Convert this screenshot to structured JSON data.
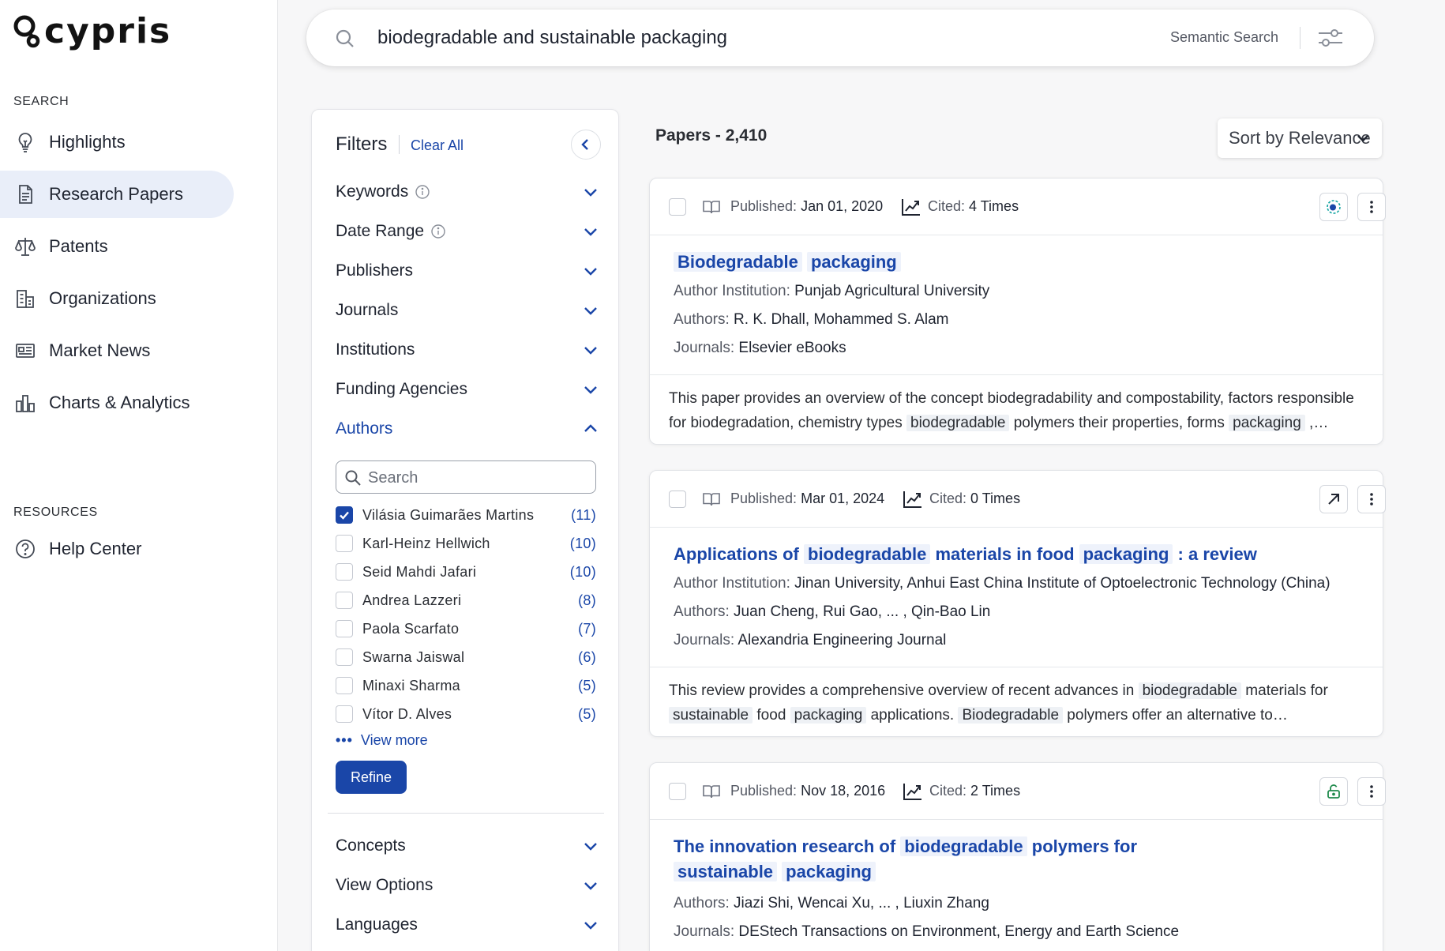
{
  "brand": {
    "name": "cypris"
  },
  "sidebar": {
    "search_heading": "SEARCH",
    "items": [
      {
        "label": "Highlights",
        "icon": "lightbulb-icon"
      },
      {
        "label": "Research Papers",
        "icon": "document-icon",
        "active": true
      },
      {
        "label": "Patents",
        "icon": "scale-icon"
      },
      {
        "label": "Organizations",
        "icon": "building-icon"
      },
      {
        "label": "Market News",
        "icon": "news-icon"
      },
      {
        "label": "Charts & Analytics",
        "icon": "bar-chart-icon"
      }
    ],
    "resources_heading": "RESOURCES",
    "resources": [
      {
        "label": "Help Center",
        "icon": "help-icon"
      }
    ]
  },
  "search": {
    "query": "biodegradable and sustainable packaging",
    "mode_label": "Semantic Search"
  },
  "filters": {
    "title": "Filters",
    "clear_all": "Clear All",
    "groups": [
      {
        "label": "Keywords",
        "has_info": true
      },
      {
        "label": "Date Range",
        "has_info": true
      },
      {
        "label": "Publishers"
      },
      {
        "label": "Journals"
      },
      {
        "label": "Institutions"
      },
      {
        "label": "Funding Agencies"
      },
      {
        "label": "Authors",
        "open": true
      }
    ],
    "author_search_placeholder": "Search",
    "authors": [
      {
        "name": "Vilásia Guimarães Martins",
        "count": "(11)",
        "checked": true
      },
      {
        "name": "Karl-Heinz Hellwich",
        "count": "(10)"
      },
      {
        "name": "Seid Mahdi Jafari",
        "count": "(10)"
      },
      {
        "name": "Andrea Lazzeri",
        "count": "(8)"
      },
      {
        "name": "Paola Scarfato",
        "count": "(7)"
      },
      {
        "name": "Swarna Jaiswal",
        "count": "(6)"
      },
      {
        "name": "Minaxi Sharma",
        "count": "(5)"
      },
      {
        "name": "Vítor D. Alves",
        "count": "(5)"
      }
    ],
    "view_more": "View more",
    "refine": "Refine",
    "lower_groups": [
      {
        "label": "Concepts"
      },
      {
        "label": "View Options"
      },
      {
        "label": "Languages"
      }
    ]
  },
  "results": {
    "count_label": "Papers - 2,410",
    "sort_label": "Sort by Relevance",
    "papers": [
      {
        "published_label": "Published:",
        "published": "Jan 01, 2020",
        "cited_label": "Cited:",
        "cited": "4 Times",
        "action_icon": "open-access-dot-icon",
        "title_parts": [
          {
            "t": "Biodegradable",
            "hl": true
          },
          {
            "t": " "
          },
          {
            "t": "packaging",
            "hl": true
          }
        ],
        "lines": [
          {
            "label": "Author Institution:",
            "value": "Punjab Agricultural University"
          },
          {
            "label": "Authors:",
            "value": "R. K. Dhall, Mohammed S. Alam"
          },
          {
            "label": "Journals:",
            "value": "Elsevier eBooks"
          }
        ],
        "abstract_parts": [
          {
            "t": "This paper provides an overview of the concept biodegradability and compostability, factors responsible for biodegradation, chemistry types "
          },
          {
            "t": "biodegradable",
            "hl": true
          },
          {
            "t": " polymers their properties, forms "
          },
          {
            "t": "packaging",
            "hl": true
          },
          {
            "t": " ,…"
          }
        ]
      },
      {
        "published_label": "Published:",
        "published": "Mar 01, 2024",
        "cited_label": "Cited:",
        "cited": "0 Times",
        "action_icon": "external-link-icon",
        "title_parts": [
          {
            "t": "Applications of "
          },
          {
            "t": "biodegradable",
            "hl": true
          },
          {
            "t": " materials in food "
          },
          {
            "t": "packaging",
            "hl": true
          },
          {
            "t": " : a review"
          }
        ],
        "lines": [
          {
            "label": "Author Institution:",
            "value": "Jinan University, Anhui East China Institute of Optoelectronic Technology (China)"
          },
          {
            "label": "Authors:",
            "value": "Juan Cheng, Rui Gao, ... , Qin-Bao Lin"
          },
          {
            "label": "Journals:",
            "value": "Alexandria Engineering Journal"
          }
        ],
        "abstract_parts": [
          {
            "t": "This review provides a comprehensive overview of recent advances in "
          },
          {
            "t": "biodegradable",
            "hl": true
          },
          {
            "t": " materials for "
          },
          {
            "t": "sustainable",
            "hl": true
          },
          {
            "t": " food "
          },
          {
            "t": "packaging",
            "hl": true
          },
          {
            "t": " applications. "
          },
          {
            "t": "Biodegradable",
            "hl": true
          },
          {
            "t": " polymers offer an alternative to conventiona…"
          }
        ]
      },
      {
        "published_label": "Published:",
        "published": "Nov 18, 2016",
        "cited_label": "Cited:",
        "cited": "2 Times",
        "action_icon": "unlock-icon",
        "title_parts": [
          {
            "t": "The innovation research of "
          },
          {
            "t": "biodegradable",
            "hl": true
          },
          {
            "t": " polymers for "
          },
          {
            "t": "sustainable",
            "hl": true
          },
          {
            "t": " "
          },
          {
            "t": "packaging",
            "hl": true
          }
        ],
        "lines": [
          {
            "label": "Authors:",
            "value": "Jiazi Shi, Wencai Xu, ... , Liuxin Zhang"
          },
          {
            "label": "Journals:",
            "value": "DEStech Transactions on Environment, Energy and Earth Science"
          }
        ],
        "abstract_parts": []
      }
    ]
  },
  "colors": {
    "accent": "#1a46a8",
    "active_bg": "#e9eef9",
    "highlight_bg": "#eef2fb"
  }
}
